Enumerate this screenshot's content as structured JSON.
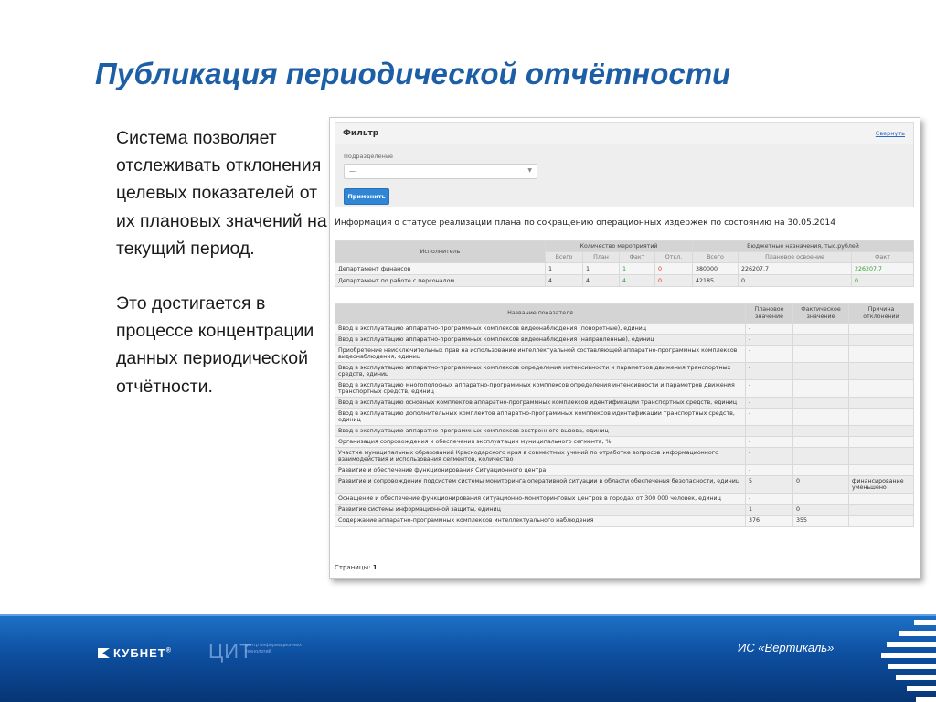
{
  "slide": {
    "title": "Публикация периодической отчётности",
    "paragraph1": "Система позволяет отслеживать отклонения целевых показателей от их плановых значений на текущий период.",
    "paragraph2": "Это достигается в процессе концентрации данных периодической отчётности."
  },
  "filter": {
    "title": "Фильтр",
    "collapse_link": "Свернуть",
    "label": "Подразделение",
    "select_value": "—",
    "apply_button": "Применить"
  },
  "info_heading": "Информация о статусе реализации плана по сокращению операционных издержек по состоянию на 30.05.2014",
  "table1": {
    "headers": {
      "executor": "Исполнитель",
      "events": "Количество мероприятий",
      "budget": "Бюджетные назначения, тыс.рублей"
    },
    "subheaders": [
      "Всего",
      "План",
      "Факт",
      "Откл.",
      "Всего",
      "Плановое освоение",
      "Факт"
    ],
    "rows": [
      {
        "name": "Департамент финансов",
        "total": "1",
        "plan": "1",
        "fact": "1",
        "dev": "0",
        "b_total": "380000",
        "b_plan": "226207.7",
        "b_fact": "226207.7"
      },
      {
        "name": "Департамент по работе с персоналом",
        "total": "4",
        "plan": "4",
        "fact": "4",
        "dev": "0",
        "b_total": "42185",
        "b_plan": "0",
        "b_fact": "0"
      }
    ]
  },
  "table2": {
    "headers": {
      "name": "Название показателя",
      "plan": "Плановое значение",
      "fact": "Фактическое значение",
      "reason": "Причина отклонений"
    },
    "rows": [
      {
        "name": "Ввод в эксплуатацию аппаратно-программных комплексов видеонаблюдения (поворотные), единиц",
        "plan": "-",
        "fact": "",
        "reason": ""
      },
      {
        "name": "Ввод в эксплуатацию аппаратно-программных комплексов видеонаблюдения (направленные), единиц",
        "plan": "-",
        "fact": "",
        "reason": ""
      },
      {
        "name": "Приобретение неисключительных прав на использование интеллектуальной составляющей аппаратно-программных комплексов видеонаблюдения, единиц",
        "plan": "-",
        "fact": "",
        "reason": ""
      },
      {
        "name": "Ввод в эксплуатацию аппаратно-программных комплексов определения интенсивности и параметров движения транспортных средств, единиц",
        "plan": "-",
        "fact": "",
        "reason": ""
      },
      {
        "name": "Ввод в эксплуатацию многополосных аппаратно-программных комплексов определения интенсивности и параметров движения транспортных средств, единиц",
        "plan": "-",
        "fact": "",
        "reason": ""
      },
      {
        "name": "Ввод в эксплуатацию основных комплектов аппаратно-программных комплексов идентификации транспортных средств, единиц",
        "plan": "-",
        "fact": "",
        "reason": ""
      },
      {
        "name": "Ввод в эксплуатацию дополнительных комплектов аппаратно-программных комплексов идентификации транспортных средств, единиц",
        "plan": "-",
        "fact": "",
        "reason": ""
      },
      {
        "name": "Ввод в эксплуатацию аппаратно-программных комплексов экстренного вызова, единиц",
        "plan": "-",
        "fact": "",
        "reason": ""
      },
      {
        "name": "Организация сопровождения и обеспечения эксплуатации муниципального сегмента, %",
        "plan": "-",
        "fact": "",
        "reason": ""
      },
      {
        "name": "Участие муниципальных образований Краснодарского края в совместных учений по отработке вопросов информационного взаимодействия и использования сегментов, количество",
        "plan": "-",
        "fact": "",
        "reason": ""
      },
      {
        "name": "Развитие и обеспечение функционирования Ситуационного центра",
        "plan": "-",
        "fact": "",
        "reason": ""
      },
      {
        "name": "Развитие и сопровождение подсистем системы мониторинга оперативной ситуации в области обеспечения безопасности, единиц",
        "plan": "5",
        "fact": "0",
        "reason": "финансирование уменьшено"
      },
      {
        "name": "Оснащение и обеспечение функционирования ситуационно-мониторинговых центров в городах от 300 000 человек, единиц",
        "plan": "-",
        "fact": "",
        "reason": ""
      },
      {
        "name": "Развитие системы информационной защиты, единиц",
        "plan": "1",
        "fact": "0",
        "reason": ""
      },
      {
        "name": "Содержание аппаратно-программных комплексов интеллектуального наблюдения",
        "plan": "376",
        "fact": "355",
        "reason": ""
      }
    ]
  },
  "pagination": {
    "label": "Страницы:",
    "current": "1"
  },
  "footer": {
    "brand": "КУБНЕТ",
    "brand_mark": "®",
    "cit_logo": "ЦИТ",
    "cit_caption": "центр информационных технологий",
    "system_name": "ИС «Вертикаль»"
  },
  "colors": {
    "title": "#1d5fa6",
    "footer": "#0d4fa0",
    "link": "#2a6ac0",
    "button": "#2f85d6",
    "positive": "#2e9a2e",
    "negative": "#d9302c"
  }
}
